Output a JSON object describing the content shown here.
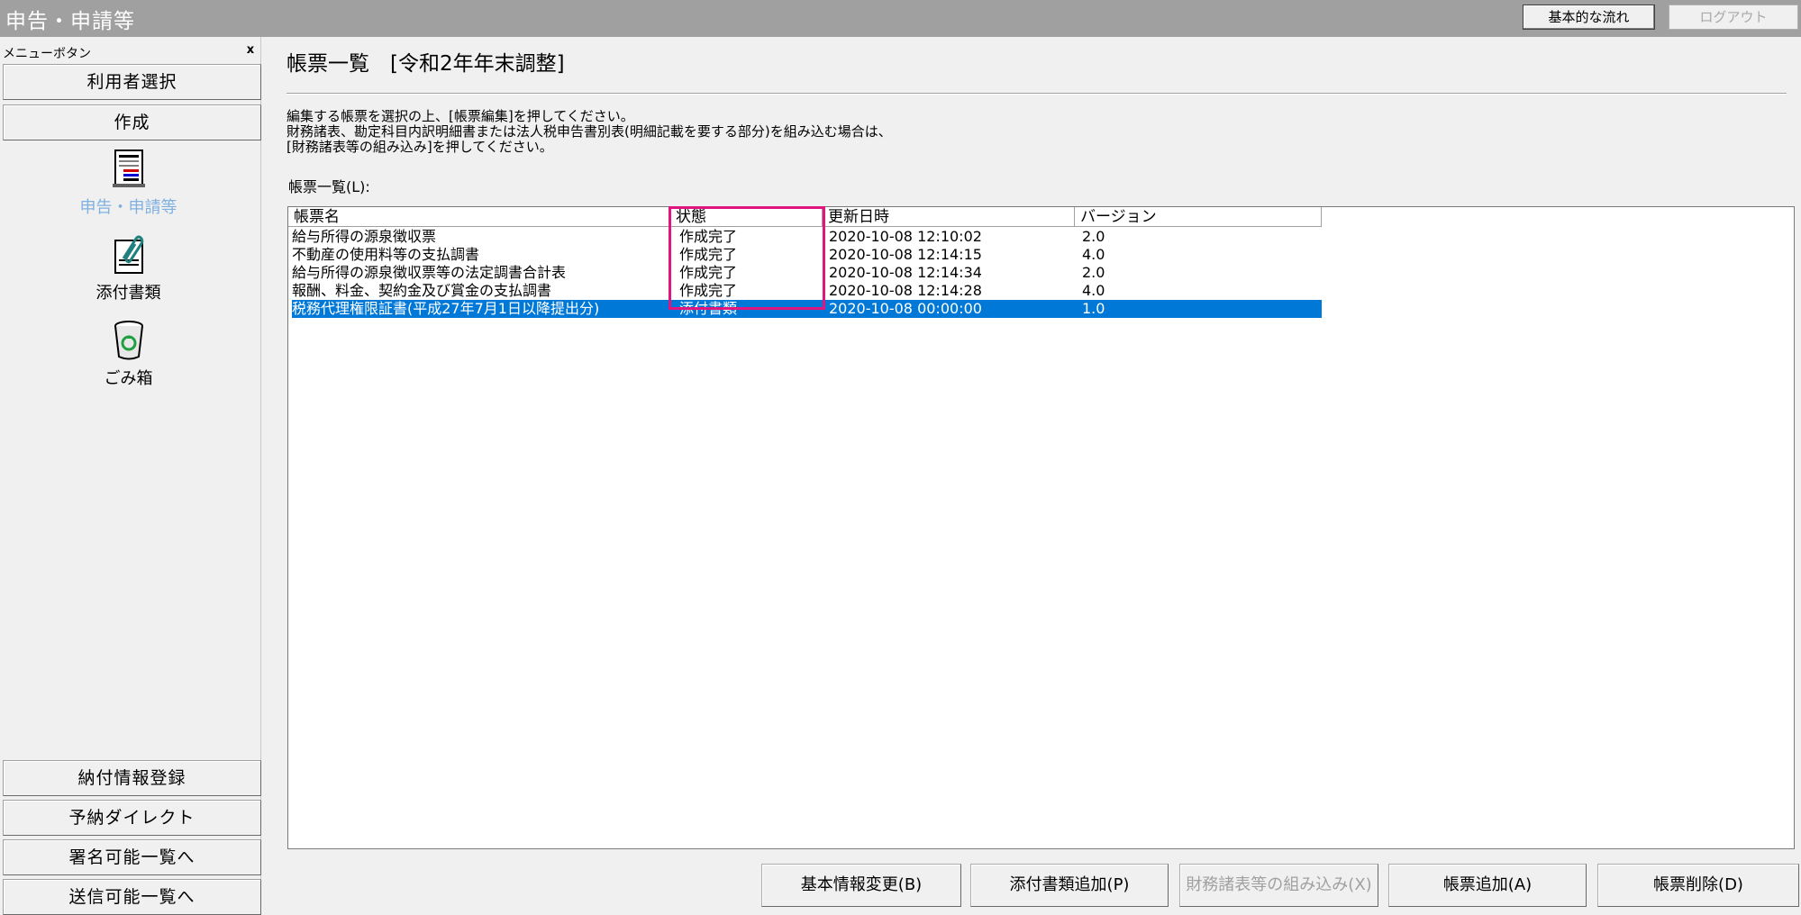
{
  "app": {
    "title": "申告・申請等",
    "flow_button": "基本的な流れ",
    "logout_button": "ログアウト"
  },
  "sidebar": {
    "caption": "メニューボタン",
    "close_glyph": "x",
    "top_buttons": [
      "利用者選択",
      "作成"
    ],
    "icons": [
      {
        "label": "申告・申請等",
        "icon": "document-form-icon",
        "active": true
      },
      {
        "label": "添付書類",
        "icon": "paperclip-icon",
        "active": false
      },
      {
        "label": "ごみ箱",
        "icon": "recycle-bin-icon",
        "active": false
      }
    ],
    "bottom_buttons": [
      "納付情報登録",
      "予納ダイレクト",
      "署名可能一覧へ",
      "送信可能一覧へ"
    ]
  },
  "main": {
    "page_title": "帳票一覧　[令和2年年末調整]",
    "instructions": [
      "編集する帳票を選択の上、[帳票編集]を押してください。",
      "財務諸表、勘定科目内訳明細書または法人税申告書別表(明細記載を要する部分)を組み込む場合は、",
      "[財務諸表等の組み込み]を押してください。"
    ],
    "list_label": "帳票一覧(L):",
    "columns": [
      "帳票名",
      "状態",
      "更新日時",
      "バージョン"
    ],
    "rows": [
      {
        "name": "給与所得の源泉徴収票",
        "status": "作成完了",
        "updated": "2020-10-08 12:10:02",
        "version": "2.0",
        "selected": false
      },
      {
        "name": "不動産の使用料等の支払調書",
        "status": "作成完了",
        "updated": "2020-10-08 12:14:15",
        "version": "4.0",
        "selected": false
      },
      {
        "name": "給与所得の源泉徴収票等の法定調書合計表",
        "status": "作成完了",
        "updated": "2020-10-08 12:14:34",
        "version": "2.0",
        "selected": false
      },
      {
        "name": "報酬、料金、契約金及び賞金の支払調書",
        "status": "作成完了",
        "updated": "2020-10-08 12:14:28",
        "version": "4.0",
        "selected": false
      },
      {
        "name": "税務代理権限証書(平成27年7月1日以降提出分)",
        "status": "添付書類",
        "updated": "2020-10-08 00:00:00",
        "version": "1.0",
        "selected": true
      }
    ],
    "highlight_color": "#e0157d",
    "selection_color": "#0078d7"
  },
  "buttons": {
    "basic_info": "基本情報変更(B)",
    "add_attachment": "添付書類追加(P)",
    "import_financial": "財務諸表等の組み込み(X)",
    "add_form": "帳票追加(A)",
    "delete_form": "帳票削除(D)"
  }
}
